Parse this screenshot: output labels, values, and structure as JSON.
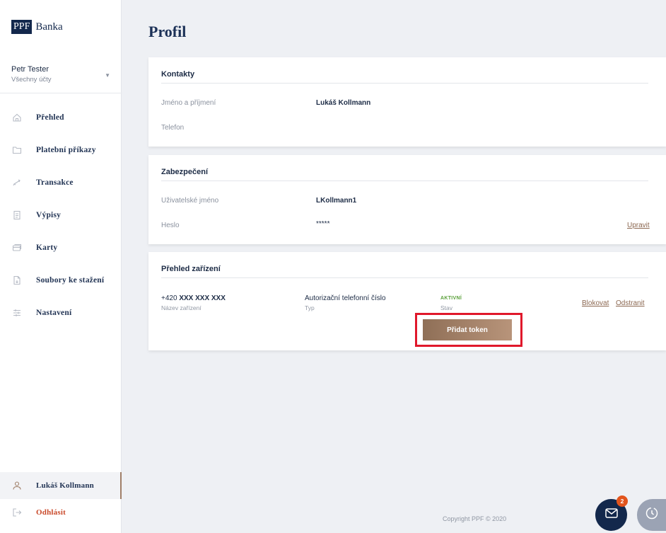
{
  "logo": {
    "box": "PPF",
    "text": "Banka"
  },
  "user_switch": {
    "name": "Petr Tester",
    "accounts": "Všechny účty"
  },
  "nav": [
    {
      "label": "Přehled",
      "icon": "home-icon"
    },
    {
      "label": "Platební příkazy",
      "icon": "folder-icon"
    },
    {
      "label": "Transakce",
      "icon": "transfer-icon"
    },
    {
      "label": "Výpisy",
      "icon": "document-icon"
    },
    {
      "label": "Karty",
      "icon": "card-icon"
    },
    {
      "label": "Soubory ke stažení",
      "icon": "file-download-icon"
    },
    {
      "label": "Nastavení",
      "icon": "settings-sliders-icon"
    }
  ],
  "bottom_nav": {
    "profile": "Lukáš Kollmann",
    "logout": "Odhlásit"
  },
  "page_title": "Profil",
  "contacts": {
    "title": "Kontakty",
    "name_label": "Jméno a příjmení",
    "name_value": "Lukáš Kollmann",
    "phone_label": "Telefon"
  },
  "security": {
    "title": "Zabezpečení",
    "username_label": "Uživatelské jméno",
    "username_value": "LKollmann1",
    "password_label": "Heslo",
    "password_value": "*****",
    "edit_link": "Upravit"
  },
  "devices": {
    "title": "Přehled zařízení",
    "row": {
      "prefix": "+420",
      "number": "XXX XXX XXX",
      "name_label": "Název zařízení",
      "type_value": "Autorizační telefonní číslo",
      "type_label": "Typ",
      "status_value": "AKTIVNÍ",
      "status_label": "Stav",
      "block_link": "Blokovat",
      "remove_link": "Odstranit"
    },
    "add_token_button": "Přidat token"
  },
  "copyright": "Copyright PPF © 2020",
  "fab": {
    "badge": "2"
  },
  "colors": {
    "navy": "#13284c",
    "accent": "#a07f68",
    "logout": "#c9492a",
    "highlight": "#e0182b",
    "active_status": "#5aa03a"
  }
}
